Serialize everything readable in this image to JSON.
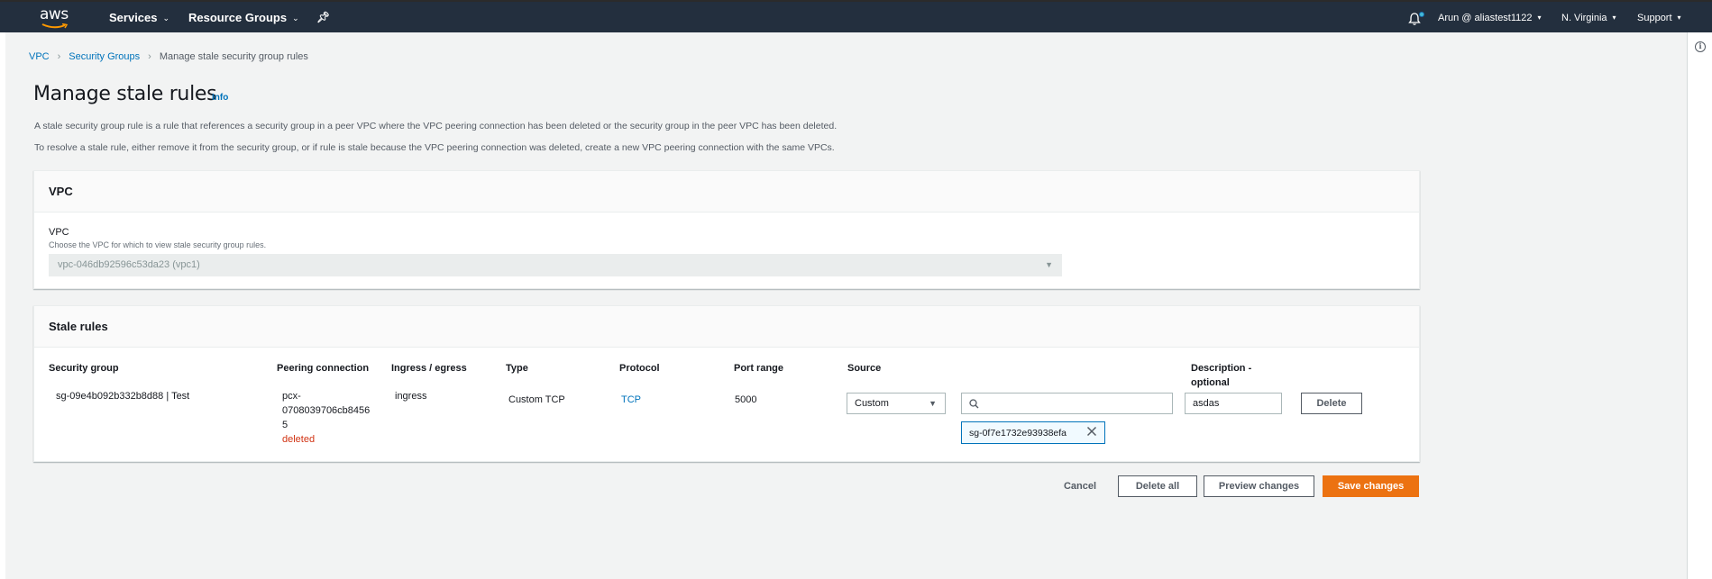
{
  "topbar": {
    "logo_text": "aws",
    "services_label": "Services",
    "resource_groups_label": "Resource Groups",
    "pin_icon": "pin-icon",
    "notifications_icon": "bell-icon",
    "account_label": "Arun @ aliastest1122",
    "region_label": "N. Virginia",
    "support_label": "Support"
  },
  "breadcrumb": {
    "items": [
      {
        "label": "VPC",
        "link": true
      },
      {
        "label": "Security Groups",
        "link": true
      },
      {
        "label": "Manage stale security group rules",
        "link": false
      }
    ],
    "separator": ">"
  },
  "page": {
    "title": "Manage stale rules",
    "info_label": "Info",
    "description_1": "A stale security group rule is a rule that references a security group in a peer VPC where the VPC peering connection has been deleted or the security group in the peer VPC has been deleted.",
    "description_2": "To resolve a stale rule, either remove it from the security group, or if rule is stale because the VPC peering connection was deleted, create a new VPC peering connection with the same VPCs."
  },
  "vpc_panel": {
    "heading": "VPC",
    "field_label": "VPC",
    "field_description": "Choose the VPC for which to view stale security group rules.",
    "selected_vpc": "vpc-046db92596c53da23 (vpc1)"
  },
  "rules_panel": {
    "heading": "Stale rules",
    "columns": {
      "security_group": "Security group",
      "peering_connection": "Peering connection",
      "ingress_egress": "Ingress / egress",
      "type": "Type",
      "protocol": "Protocol",
      "port_range": "Port range",
      "source": "Source",
      "description_line1": "Description -",
      "description_line2": "optional"
    },
    "rows": [
      {
        "security_group_id": "sg-09e4b092b332b8d88",
        "security_group_sep": "|",
        "security_group_name": "Test",
        "peering_line1": "pcx-",
        "peering_line2": "0708039706cb8456",
        "peering_line3": "5",
        "peering_status": "deleted",
        "ingress_egress": "ingress",
        "type": "Custom TCP",
        "protocol": "TCP",
        "port_range": "5000",
        "source_type": "Custom",
        "source_search_value": "",
        "source_token": "sg-0f7e1732e93938efa",
        "description": "asdas",
        "delete_label": "Delete"
      }
    ]
  },
  "actions": {
    "cancel": "Cancel",
    "delete_all": "Delete all",
    "preview": "Preview changes",
    "save": "Save changes"
  },
  "colors": {
    "nav_bg": "#232f3e",
    "link": "#0073bb",
    "primary": "#ec7211",
    "deleted": "#d13212",
    "page_bg": "#f2f3f3"
  }
}
